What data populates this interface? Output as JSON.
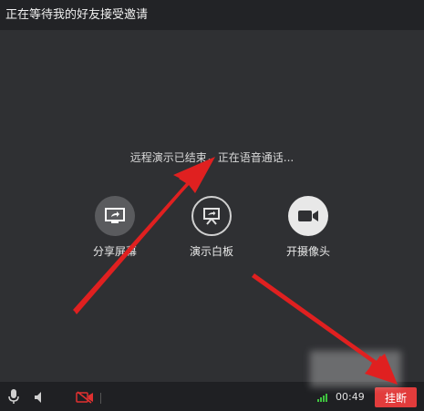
{
  "window": {
    "title": "正在等待我的好友接受邀请"
  },
  "main": {
    "status_text": "远程演示已结束，正在语音通话...",
    "actions": [
      {
        "label": "分享屏幕",
        "icon": "share-screen-icon"
      },
      {
        "label": "演示白板",
        "icon": "whiteboard-icon"
      },
      {
        "label": "开摄像头",
        "icon": "camera-icon"
      }
    ]
  },
  "bottombar": {
    "icons": [
      "microphone-icon",
      "speaker-icon",
      "camera-off-icon"
    ],
    "timer": "00:49",
    "hangup_label": "挂断"
  },
  "colors": {
    "background": "#2f3033",
    "titlebar": "#222326",
    "hangup": "#e23c3c",
    "annotation_arrow": "#e02020",
    "signal": "#3fc23f"
  }
}
